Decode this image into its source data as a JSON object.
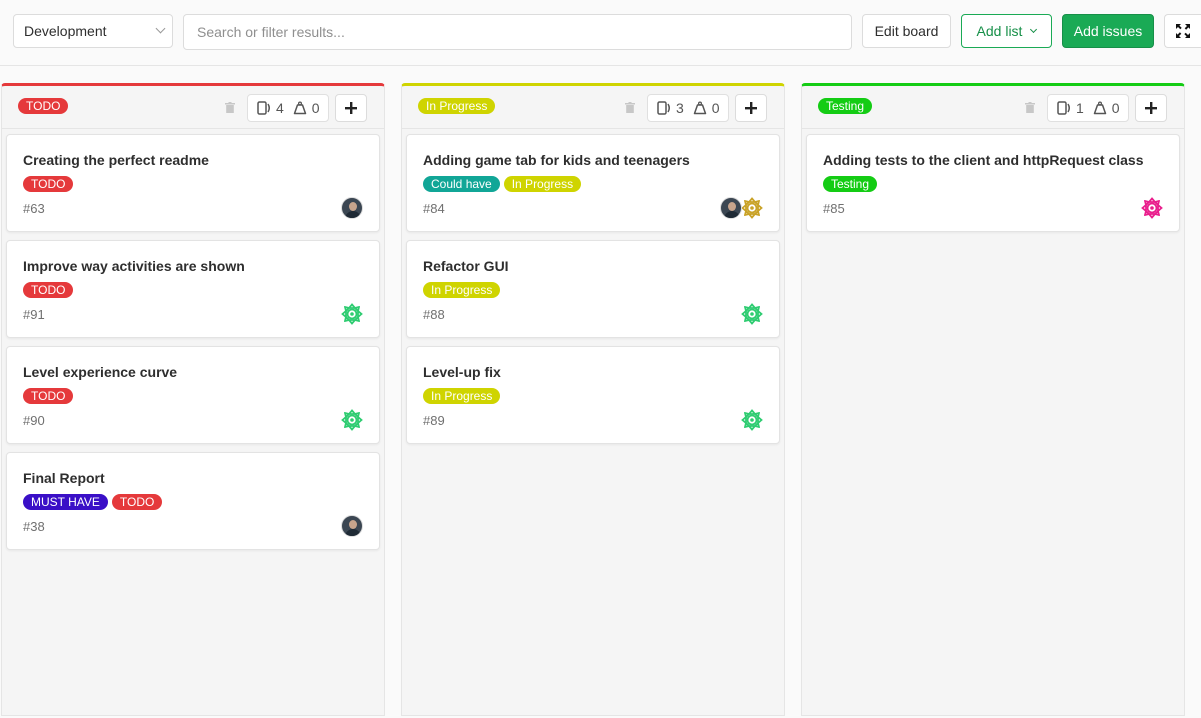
{
  "toolbar": {
    "board_select": "Development",
    "search_placeholder": "Search or filter results...",
    "edit_board": "Edit board",
    "add_list": "Add list",
    "add_issues": "Add issues"
  },
  "lists": [
    {
      "label": "TODO",
      "color": "#e5393b",
      "issue_count": "4",
      "weight": "0",
      "cards": [
        {
          "title": "Creating the perfect readme",
          "labels": [
            {
              "text": "TODO",
              "color": "#e5393b"
            }
          ],
          "number": "#63",
          "avatars": [
            "photo-avatar"
          ]
        },
        {
          "title": "Improve way activities are shown",
          "labels": [
            {
              "text": "TODO",
              "color": "#e5393b"
            }
          ],
          "number": "#91",
          "avatars": [
            "green-identicon"
          ]
        },
        {
          "title": "Level experience curve",
          "labels": [
            {
              "text": "TODO",
              "color": "#e5393b"
            }
          ],
          "number": "#90",
          "avatars": [
            "green-identicon"
          ]
        },
        {
          "title": "Final Report",
          "labels": [
            {
              "text": "MUST HAVE",
              "color": "#3a0fc7"
            },
            {
              "text": "TODO",
              "color": "#e5393b"
            }
          ],
          "number": "#38",
          "avatars": [
            "photo-avatar"
          ]
        }
      ]
    },
    {
      "label": "In Progress",
      "color": "#cfd400",
      "issue_count": "3",
      "weight": "0",
      "cards": [
        {
          "title": "Adding game tab for kids and teenagers",
          "labels": [
            {
              "text": "Could have",
              "color": "#11a697"
            },
            {
              "text": "In Progress",
              "color": "#cfd400"
            }
          ],
          "number": "#84",
          "avatars": [
            "photo-avatar",
            "gold-identicon"
          ]
        },
        {
          "title": "Refactor GUI",
          "labels": [
            {
              "text": "In Progress",
              "color": "#cfd400"
            }
          ],
          "number": "#88",
          "avatars": [
            "green-identicon"
          ]
        },
        {
          "title": "Level-up fix",
          "labels": [
            {
              "text": "In Progress",
              "color": "#cfd400"
            }
          ],
          "number": "#89",
          "avatars": [
            "green-identicon"
          ]
        }
      ]
    },
    {
      "label": "Testing",
      "color": "#14cc14",
      "issue_count": "1",
      "weight": "0",
      "cards": [
        {
          "title": "Adding tests to the client and httpRequest class",
          "labels": [
            {
              "text": "Testing",
              "color": "#14cc14"
            }
          ],
          "number": "#85",
          "avatars": [
            "pink-identicon"
          ]
        }
      ]
    }
  ],
  "identicon_colors": {
    "green-identicon": "#2ecc71",
    "gold-identicon": "#c9a227",
    "pink-identicon": "#e91e8c"
  }
}
